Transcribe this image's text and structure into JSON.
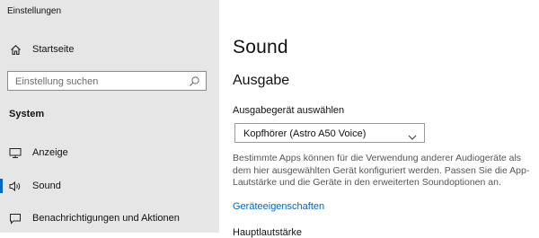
{
  "window": {
    "title": "Einstellungen"
  },
  "sidebar": {
    "home": {
      "label": "Startseite",
      "icon": "home-icon"
    },
    "search": {
      "placeholder": "Einstellung suchen",
      "icon": "search-icon"
    },
    "section": "System",
    "items": [
      {
        "label": "Anzeige",
        "icon": "monitor-icon",
        "active": false
      },
      {
        "label": "Sound",
        "icon": "speaker-icon",
        "active": true
      },
      {
        "label": "Benachrichtigungen und Aktionen",
        "icon": "notification-icon",
        "active": false
      }
    ]
  },
  "main": {
    "title": "Sound",
    "output_heading": "Ausgabe",
    "device_label": "Ausgabegerät auswählen",
    "device_value": "Kopfhörer (Astro A50 Voice)",
    "description": "Bestimmte Apps können für die Verwendung anderer Audiogeräte als dem hier ausgewählten Gerät konfiguriert werden. Passen Sie die App-Lautstärke und die Geräte in den erweiterten Soundoptionen an.",
    "device_properties_link": "Geräteeigenschaften",
    "master_volume_heading": "Hauptlautstärke"
  },
  "colors": {
    "accent": "#0067c0",
    "sidebar_bg": "#e6e6e6",
    "link": "#0067c0"
  }
}
